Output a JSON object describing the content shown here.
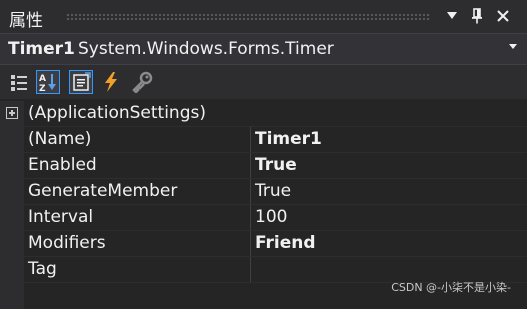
{
  "window": {
    "title": "属性",
    "buttons": [
      {
        "name": "dropdown-icon",
        "glyph": "▼"
      },
      {
        "name": "pin-icon",
        "glyph": "📌"
      },
      {
        "name": "close-icon",
        "glyph": "✕"
      }
    ]
  },
  "object_selector": {
    "name": "Timer1",
    "type": "System.Windows.Forms.Timer"
  },
  "toolbar": {
    "items": [
      {
        "name": "categorized-icon",
        "active": false
      },
      {
        "name": "alphabetical-icon",
        "active": true
      },
      {
        "name": "properties-icon",
        "active": true
      },
      {
        "name": "events-icon",
        "active": false
      },
      {
        "name": "property-pages-icon",
        "active": false
      }
    ]
  },
  "properties": {
    "rows": [
      {
        "name": "(ApplicationSettings)",
        "value": "",
        "bold": false,
        "expandable": true
      },
      {
        "name": "(Name)",
        "value": "Timer1",
        "bold": true,
        "expandable": false
      },
      {
        "name": "Enabled",
        "value": "True",
        "bold": true,
        "expandable": false
      },
      {
        "name": "GenerateMember",
        "value": "True",
        "bold": false,
        "expandable": false
      },
      {
        "name": "Interval",
        "value": "100",
        "bold": false,
        "expandable": false
      },
      {
        "name": "Modifiers",
        "value": "Friend",
        "bold": true,
        "expandable": false
      },
      {
        "name": "Tag",
        "value": "",
        "bold": false,
        "expandable": false
      }
    ]
  },
  "watermark": "CSDN @-小柒不是小染-",
  "colors": {
    "background": "#252526",
    "panel": "#2d2d30",
    "accent": "#3399ff",
    "events": "#f0a028"
  }
}
